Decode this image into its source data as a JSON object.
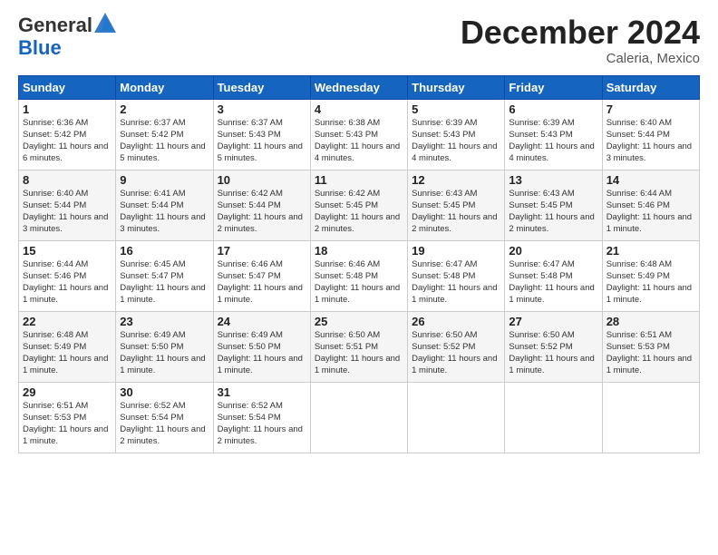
{
  "header": {
    "logo_general": "General",
    "logo_blue": "Blue",
    "month": "December 2024",
    "location": "Caleria, Mexico"
  },
  "days_of_week": [
    "Sunday",
    "Monday",
    "Tuesday",
    "Wednesday",
    "Thursday",
    "Friday",
    "Saturday"
  ],
  "weeks": [
    [
      {
        "day": "1",
        "sunrise": "6:36 AM",
        "sunset": "5:42 PM",
        "daylight": "11 hours and 6 minutes."
      },
      {
        "day": "2",
        "sunrise": "6:37 AM",
        "sunset": "5:42 PM",
        "daylight": "11 hours and 5 minutes."
      },
      {
        "day": "3",
        "sunrise": "6:37 AM",
        "sunset": "5:43 PM",
        "daylight": "11 hours and 5 minutes."
      },
      {
        "day": "4",
        "sunrise": "6:38 AM",
        "sunset": "5:43 PM",
        "daylight": "11 hours and 4 minutes."
      },
      {
        "day": "5",
        "sunrise": "6:39 AM",
        "sunset": "5:43 PM",
        "daylight": "11 hours and 4 minutes."
      },
      {
        "day": "6",
        "sunrise": "6:39 AM",
        "sunset": "5:43 PM",
        "daylight": "11 hours and 4 minutes."
      },
      {
        "day": "7",
        "sunrise": "6:40 AM",
        "sunset": "5:44 PM",
        "daylight": "11 hours and 3 minutes."
      }
    ],
    [
      {
        "day": "8",
        "sunrise": "6:40 AM",
        "sunset": "5:44 PM",
        "daylight": "11 hours and 3 minutes."
      },
      {
        "day": "9",
        "sunrise": "6:41 AM",
        "sunset": "5:44 PM",
        "daylight": "11 hours and 3 minutes."
      },
      {
        "day": "10",
        "sunrise": "6:42 AM",
        "sunset": "5:44 PM",
        "daylight": "11 hours and 2 minutes."
      },
      {
        "day": "11",
        "sunrise": "6:42 AM",
        "sunset": "5:45 PM",
        "daylight": "11 hours and 2 minutes."
      },
      {
        "day": "12",
        "sunrise": "6:43 AM",
        "sunset": "5:45 PM",
        "daylight": "11 hours and 2 minutes."
      },
      {
        "day": "13",
        "sunrise": "6:43 AM",
        "sunset": "5:45 PM",
        "daylight": "11 hours and 2 minutes."
      },
      {
        "day": "14",
        "sunrise": "6:44 AM",
        "sunset": "5:46 PM",
        "daylight": "11 hours and 1 minute."
      }
    ],
    [
      {
        "day": "15",
        "sunrise": "6:44 AM",
        "sunset": "5:46 PM",
        "daylight": "11 hours and 1 minute."
      },
      {
        "day": "16",
        "sunrise": "6:45 AM",
        "sunset": "5:47 PM",
        "daylight": "11 hours and 1 minute."
      },
      {
        "day": "17",
        "sunrise": "6:46 AM",
        "sunset": "5:47 PM",
        "daylight": "11 hours and 1 minute."
      },
      {
        "day": "18",
        "sunrise": "6:46 AM",
        "sunset": "5:48 PM",
        "daylight": "11 hours and 1 minute."
      },
      {
        "day": "19",
        "sunrise": "6:47 AM",
        "sunset": "5:48 PM",
        "daylight": "11 hours and 1 minute."
      },
      {
        "day": "20",
        "sunrise": "6:47 AM",
        "sunset": "5:48 PM",
        "daylight": "11 hours and 1 minute."
      },
      {
        "day": "21",
        "sunrise": "6:48 AM",
        "sunset": "5:49 PM",
        "daylight": "11 hours and 1 minute."
      }
    ],
    [
      {
        "day": "22",
        "sunrise": "6:48 AM",
        "sunset": "5:49 PM",
        "daylight": "11 hours and 1 minute."
      },
      {
        "day": "23",
        "sunrise": "6:49 AM",
        "sunset": "5:50 PM",
        "daylight": "11 hours and 1 minute."
      },
      {
        "day": "24",
        "sunrise": "6:49 AM",
        "sunset": "5:50 PM",
        "daylight": "11 hours and 1 minute."
      },
      {
        "day": "25",
        "sunrise": "6:50 AM",
        "sunset": "5:51 PM",
        "daylight": "11 hours and 1 minute."
      },
      {
        "day": "26",
        "sunrise": "6:50 AM",
        "sunset": "5:52 PM",
        "daylight": "11 hours and 1 minute."
      },
      {
        "day": "27",
        "sunrise": "6:50 AM",
        "sunset": "5:52 PM",
        "daylight": "11 hours and 1 minute."
      },
      {
        "day": "28",
        "sunrise": "6:51 AM",
        "sunset": "5:53 PM",
        "daylight": "11 hours and 1 minute."
      }
    ],
    [
      {
        "day": "29",
        "sunrise": "6:51 AM",
        "sunset": "5:53 PM",
        "daylight": "11 hours and 1 minute."
      },
      {
        "day": "30",
        "sunrise": "6:52 AM",
        "sunset": "5:54 PM",
        "daylight": "11 hours and 2 minutes."
      },
      {
        "day": "31",
        "sunrise": "6:52 AM",
        "sunset": "5:54 PM",
        "daylight": "11 hours and 2 minutes."
      },
      null,
      null,
      null,
      null
    ]
  ]
}
